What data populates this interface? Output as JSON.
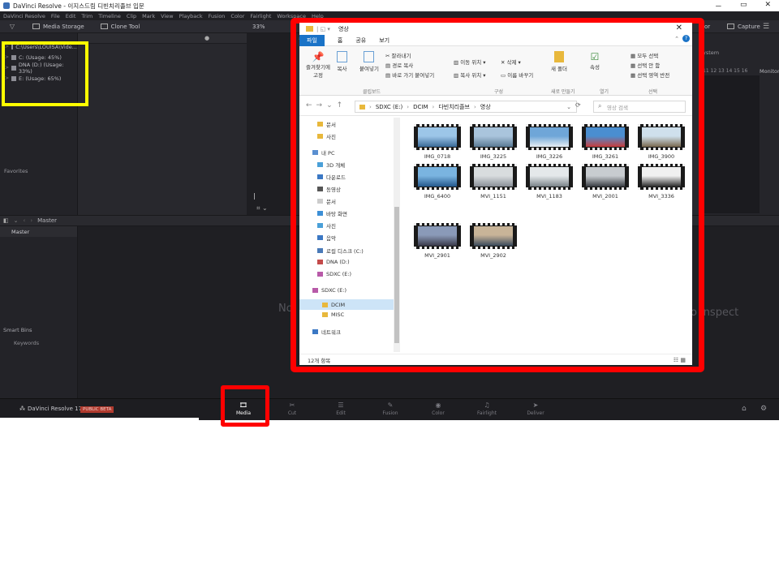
{
  "titlebar": {
    "title": "DaVinci Resolve - 이지스드림 디빈치리졸브 입문",
    "min": "－",
    "max": "▭",
    "close": "✕"
  },
  "menubar": [
    "DaVinci Resolve",
    "File",
    "Edit",
    "Trim",
    "Timeline",
    "Clip",
    "Mark",
    "View",
    "Playback",
    "Fusion",
    "Color",
    "Fairlight",
    "Workspace",
    "Help"
  ],
  "toolbar": {
    "media_storage": "Media Storage",
    "clone_tool": "Clone Tool",
    "zoom": "33%",
    "capture": "Capture",
    "inspector_partial": "or"
  },
  "drives": [
    "C:\\Users\\LOUISA\\Vide...",
    "C: (Usage: 45%)",
    "DNA (D:) (Usage: 33%)",
    "E: (Usage: 65%)"
  ],
  "favorites_label": "Favorites",
  "bottom_bar": {
    "master": "Master"
  },
  "bins": {
    "master": "Master",
    "smart_bins": "Smart Bins",
    "keywords": "Keywords"
  },
  "media_pool": {
    "no_clip_left": "No",
    "no_clip_right": "o inspect"
  },
  "right_panel": {
    "timecode": "ystem",
    "ruler": "11 12 13 14 15 16",
    "metadata": "Monitor"
  },
  "pages": {
    "brand": "DaVinci Resolve 17",
    "beta": "PUBLIC BETA",
    "tabs": [
      {
        "label": "Media",
        "icon": "🎞"
      },
      {
        "label": "Cut",
        "icon": "✂"
      },
      {
        "label": "Edit",
        "icon": "☰"
      },
      {
        "label": "Fusion",
        "icon": "✎"
      },
      {
        "label": "Color",
        "icon": "◉"
      },
      {
        "label": "Fairlight",
        "icon": "♫"
      },
      {
        "label": "Deliver",
        "icon": "➤"
      }
    ],
    "home_icon": "⌂",
    "gear_icon": "⚙"
  },
  "explorer": {
    "title": "영상",
    "tabs": [
      "파일",
      "홈",
      "공유",
      "보기"
    ],
    "ribbon": {
      "pin": "즐겨찾기에 고정",
      "copy": "복사",
      "paste": "붙여넣기",
      "cut": "잘라내기",
      "copy_path": "경로 복사",
      "paste_shortcut": "바로 가기 붙여넣기",
      "move_to": "이동 위치",
      "copy_to": "복사 위치",
      "delete": "삭제",
      "rename": "이름 바꾸기",
      "new_folder": "새 폴더",
      "properties": "속성",
      "select_all": "모두 선택",
      "select_none": "선택 안 함",
      "invert": "선택 영역 반전",
      "group_clipboard": "클립보드",
      "group_organize": "구성",
      "group_new": "새로 만들기",
      "group_open": "열기",
      "group_select": "선택"
    },
    "address": [
      "SDXC (E:)",
      "DCIM",
      "다빈치리졸브",
      "영상"
    ],
    "search_placeholder": "영상 검색",
    "nav": [
      {
        "label": "문서",
        "color": "#e8b83c"
      },
      {
        "label": "사진",
        "color": "#e8b83c"
      },
      {
        "label": "내 PC",
        "color": "#5a8fd0"
      },
      {
        "label": "3D 개체",
        "color": "#4aa0d8"
      },
      {
        "label": "다운로드",
        "color": "#3b78c4"
      },
      {
        "label": "동영상",
        "color": "#555555"
      },
      {
        "label": "문서",
        "color": "#cccccc"
      },
      {
        "label": "바탕 화면",
        "color": "#3c8fd6"
      },
      {
        "label": "사진",
        "color": "#4aa0d8"
      },
      {
        "label": "음악",
        "color": "#3b78c4"
      },
      {
        "label": "로컬 디스크 (C:)",
        "color": "#4a7ab8"
      },
      {
        "label": "DNA (D:)",
        "color": "#c44a4a"
      },
      {
        "label": "SDXC (E:)",
        "color": "#b85aa8"
      },
      {
        "label": "SDXC (E:)",
        "color": "#b85aa8"
      },
      {
        "label": "DCIM",
        "color": "#e8b83c"
      },
      {
        "label": "MISC",
        "color": "#e8b83c"
      },
      {
        "label": "네트워크",
        "color": "#3b78c4"
      }
    ],
    "files": [
      {
        "name": "IMG_0718",
        "colors": [
          "#9cc6e8",
          "#3a6a98"
        ]
      },
      {
        "name": "IMG_3225",
        "colors": [
          "#a9c4dc",
          "#5a7a94"
        ]
      },
      {
        "name": "IMG_3226",
        "colors": [
          "#6fa6d8",
          "#e6eef4"
        ]
      },
      {
        "name": "IMG_3261",
        "colors": [
          "#4a8ed0",
          "#c83c3c"
        ]
      },
      {
        "name": "IMG_3900",
        "colors": [
          "#cfe0ec",
          "#7a6a50"
        ]
      },
      {
        "name": "IMG_6400",
        "colors": [
          "#7ab4e0",
          "#24588c"
        ]
      },
      {
        "name": "MVI_1151",
        "colors": [
          "#d8dcde",
          "#8a9098"
        ]
      },
      {
        "name": "MVI_1183",
        "colors": [
          "#e4e8ea",
          "#7a8288"
        ]
      },
      {
        "name": "MVI_2001",
        "colors": [
          "#c8ccd0",
          "#3a3e44"
        ]
      },
      {
        "name": "MVI_3336",
        "colors": [
          "#f0f0f0",
          "#2a2a2a"
        ]
      },
      {
        "name": "MVI_2901",
        "colors": [
          "#8a9ab8",
          "#3a3a4a"
        ]
      },
      {
        "name": "MVI_2902",
        "colors": [
          "#c8b498",
          "#3a4a5c"
        ]
      }
    ],
    "status": "12개 항목"
  }
}
